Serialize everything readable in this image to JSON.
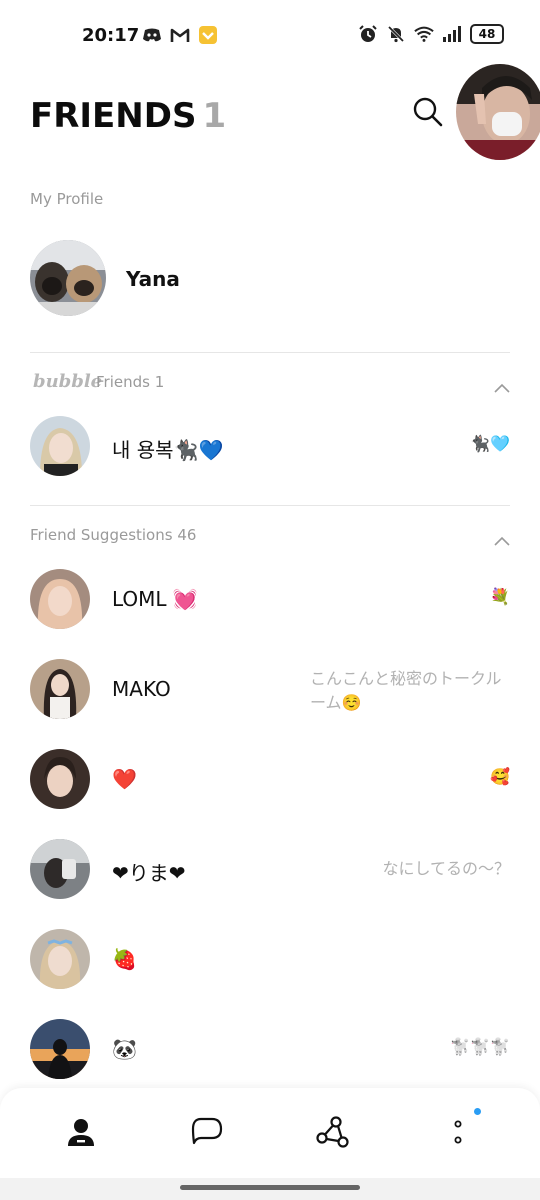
{
  "status": {
    "time": "20:17",
    "battery": "48",
    "left_icons": [
      "discord-icon",
      "gmail-icon",
      "app-badge-icon"
    ],
    "right_icons": [
      "alarm-icon",
      "mute-icon",
      "wifi-icon",
      "signal-icon"
    ]
  },
  "header": {
    "title": "FRIENDS",
    "count": "1"
  },
  "my_profile": {
    "label": "My Profile",
    "name": "Yana"
  },
  "bubble": {
    "brand": "bubble",
    "label": "Friends 1",
    "friends": [
      {
        "name": "내 용복🐈‍⬛💙",
        "emoji": "🐈‍⬛🩵"
      }
    ]
  },
  "suggestions": {
    "label": "Friend Suggestions 46",
    "items": [
      {
        "name": "LOML 💓",
        "status": "",
        "emoji": "💐"
      },
      {
        "name": "MAKO",
        "status": "こんこんと秘密のトークルーム☺️",
        "emoji": ""
      },
      {
        "name": "❤️",
        "status": "",
        "emoji": "🥰"
      },
      {
        "name": "❤りま❤",
        "status": "なにしてるの～？",
        "emoji": ""
      },
      {
        "name": "🍓",
        "status": "",
        "emoji": ""
      },
      {
        "name": "🐼",
        "status": "",
        "emoji": "🐩🐩🐩"
      }
    ]
  },
  "nav": {
    "items": [
      "friends-tab",
      "chats-tab",
      "openchat-tab",
      "more-tab"
    ],
    "accent": "#2a9df4"
  }
}
